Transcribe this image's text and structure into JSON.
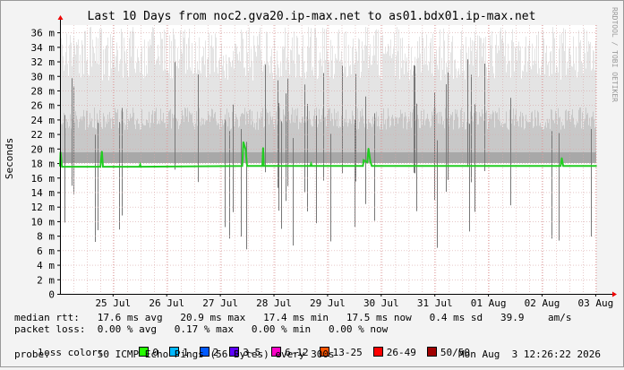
{
  "chart_data": {
    "type": "line",
    "title": "Last 10 Days from noc2.gva20.ip-max.net to as01.bdx01.ip-max.net",
    "ylabel": "Seconds",
    "xlabel": "",
    "ylim": [
      0,
      0.037
    ],
    "yticks": [
      {
        "v": 0.0,
        "label": "0"
      },
      {
        "v": 0.002,
        "label": "2 m"
      },
      {
        "v": 0.004,
        "label": "4 m"
      },
      {
        "v": 0.006,
        "label": "6 m"
      },
      {
        "v": 0.008,
        "label": "8 m"
      },
      {
        "v": 0.01,
        "label": "10 m"
      },
      {
        "v": 0.012,
        "label": "12 m"
      },
      {
        "v": 0.014,
        "label": "14 m"
      },
      {
        "v": 0.016,
        "label": "16 m"
      },
      {
        "v": 0.018,
        "label": "18 m"
      },
      {
        "v": 0.02,
        "label": "20 m"
      },
      {
        "v": 0.022,
        "label": "22 m"
      },
      {
        "v": 0.024,
        "label": "24 m"
      },
      {
        "v": 0.026,
        "label": "26 m"
      },
      {
        "v": 0.028,
        "label": "28 m"
      },
      {
        "v": 0.03,
        "label": "30 m"
      },
      {
        "v": 0.032,
        "label": "32 m"
      },
      {
        "v": 0.034,
        "label": "34 m"
      },
      {
        "v": 0.036,
        "label": "36 m"
      }
    ],
    "xlim": [
      "2026-07-24 12:26",
      "2026-08-03 12:26"
    ],
    "xticks": [
      {
        "t": "2026-07-25 12:00",
        "label": "25 Jul"
      },
      {
        "t": "2026-07-26 12:00",
        "label": "26 Jul"
      },
      {
        "t": "2026-07-27 12:00",
        "label": "27 Jul"
      },
      {
        "t": "2026-07-28 12:00",
        "label": "28 Jul"
      },
      {
        "t": "2026-07-29 12:00",
        "label": "29 Jul"
      },
      {
        "t": "2026-07-30 12:00",
        "label": "30 Jul"
      },
      {
        "t": "2026-07-31 12:00",
        "label": "31 Jul"
      },
      {
        "t": "2026-08-01 12:00",
        "label": "01 Aug"
      },
      {
        "t": "2026-08-02 12:00",
        "label": "02 Aug"
      },
      {
        "t": "2026-08-03 12:00",
        "label": "03 Aug"
      }
    ],
    "grid": true,
    "series": [
      {
        "name": "median rtt",
        "color": "#22cc22",
        "points": [
          {
            "t": "2026-07-24 12:26",
            "v": 0.0176
          },
          {
            "t": "2026-07-24 12:40",
            "v": 0.0195
          },
          {
            "t": "2026-07-24 13:20",
            "v": 0.0175
          },
          {
            "t": "2026-07-25 06:30",
            "v": 0.0175
          },
          {
            "t": "2026-07-25 07:10",
            "v": 0.0196
          },
          {
            "t": "2026-07-25 07:40",
            "v": 0.0175
          },
          {
            "t": "2026-07-26 00:00",
            "v": 0.0175
          },
          {
            "t": "2026-07-26 00:20",
            "v": 0.0178
          },
          {
            "t": "2026-07-26 00:40",
            "v": 0.0175
          },
          {
            "t": "2026-07-27 22:00",
            "v": 0.0176
          },
          {
            "t": "2026-07-27 22:30",
            "v": 0.0209
          },
          {
            "t": "2026-07-27 23:30",
            "v": 0.0199
          },
          {
            "t": "2026-07-28 00:10",
            "v": 0.0176
          },
          {
            "t": "2026-07-28 07:00",
            "v": 0.0176
          },
          {
            "t": "2026-07-28 07:20",
            "v": 0.0201
          },
          {
            "t": "2026-07-28 07:40",
            "v": 0.0176
          },
          {
            "t": "2026-07-29 04:30",
            "v": 0.0176
          },
          {
            "t": "2026-07-29 04:50",
            "v": 0.0179
          },
          {
            "t": "2026-07-29 05:10",
            "v": 0.0176
          },
          {
            "t": "2026-07-30 04:00",
            "v": 0.0176
          },
          {
            "t": "2026-07-30 04:20",
            "v": 0.0184
          },
          {
            "t": "2026-07-30 06:00",
            "v": 0.0181
          },
          {
            "t": "2026-07-30 06:30",
            "v": 0.02
          },
          {
            "t": "2026-07-30 07:20",
            "v": 0.0182
          },
          {
            "t": "2026-07-30 08:00",
            "v": 0.0176
          },
          {
            "t": "2026-08-02 20:30",
            "v": 0.0176
          },
          {
            "t": "2026-08-02 21:00",
            "v": 0.0187
          },
          {
            "t": "2026-08-02 21:40",
            "v": 0.0176
          },
          {
            "t": "2026-08-03 12:26",
            "v": 0.0176
          }
        ]
      }
    ]
  },
  "side_label": "RRDTOOL / TOBI OETIKER",
  "stats": {
    "median_rtt": "median rtt:   17.6 ms avg   20.9 ms max   17.4 ms min   17.5 ms now   0.4 ms sd   39.9    am/s",
    "packet_loss": "packet loss:  0.00 % avg   0.17 % max   0.00 % min   0.00 % now",
    "loss_color_label": "loss color:",
    "loss_colors": [
      {
        "label": "0",
        "color": "#26ff00"
      },
      {
        "label": "1",
        "color": "#00b8ff"
      },
      {
        "label": "2",
        "color": "#0059ff"
      },
      {
        "label": "3-5",
        "color": "#5e00ff"
      },
      {
        "label": "6-12",
        "color": "#ff00c8"
      },
      {
        "label": "13-25",
        "color": "#ff5500"
      },
      {
        "label": "26-49",
        "color": "#ff0000"
      },
      {
        "label": "50/50",
        "color": "#a10000"
      }
    ],
    "probe": "probe:        50 ICMP Echo Pings (56 Bytes) every 300s",
    "timestamp": "Mon Aug  3 12:26:22 2026"
  }
}
